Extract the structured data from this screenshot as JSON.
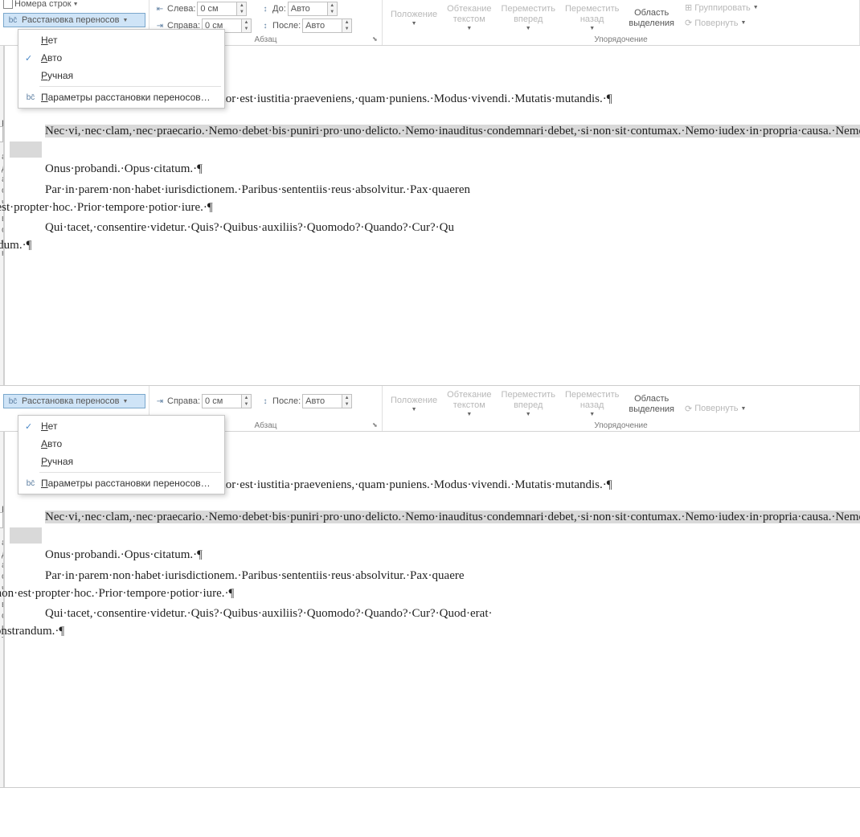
{
  "ribbon": {
    "lineNumbers": "Номера строк",
    "hyphenation": "Расстановка переносов",
    "indentLeftLabel": "Слева:",
    "indentRightLabel": "Справа:",
    "spacingBeforeLabel": "До:",
    "spacingAfterLabel": "После:",
    "indentLeftValue": "0 см",
    "indentRightValue": "0 см",
    "spacingBeforeValue": "Авто",
    "spacingAfterValue": "Авто",
    "groupParagraph": "Абзац",
    "groupArrange": "Упорядочение",
    "position": "Положение",
    "wrapText1": "Обтекание",
    "wrapText2": "текстом",
    "bringForward1": "Переместить",
    "bringForward2": "вперед",
    "sendBackward1": "Переместить",
    "sendBackward2": "назад",
    "selectionPane1": "Область",
    "selectionPane2": "выделения",
    "group": "Группировать",
    "rotate": "Повернуть"
  },
  "menu": {
    "none": "Нет",
    "auto": "Авто",
    "manual": "Ручная",
    "options": "Параметры расстановки переносов…"
  },
  "leftPane": {
    "results": "РЕЗУЛЬ",
    "frag1": "ю",
    "frag2a": "акой",
    "frag2b": "дитесь, а",
    "frag2c": "о части.",
    "frag3a": "вкладку",
    "frag3b": "оловков к",
    "frag3c": "нте.",
    "frag3b2": "оловков к",
    "frag3c2": "те."
  },
  "doc": {
    "p1": "·est·causa·possidentis.·Melior·est·iustitia·praeveniens,·quam·puniens.·Modus·vivendi.·Mutatis·mutandis.·¶",
    "p2": "Nec·vi,·nec·clam,·nec·praecario.·Nemo·debet·bis·puniri·pro·uno·delicto.·Nemo·inauditus·condemnari·debet,·si·non·sit·contumax.·Nemo·iudex·in·propria·causa.·Nemo·pluris·iuris·ad·alium·transfere·potest,·quam·ipse·haberet.·Nemo·praesens·nisi·intelligat.·Nemo·praesumitur·malus.·Non·bis·in·idem.·Non·efficit·affectus·nisi·sequatur·effectus.·Non·obligat·lex,·nisi·promulgata.·Non·omne,·quod·licet,·honestum·est.·Non·progredi·est·regredi.·Non·videtur·vim·facere,·qui·iure·suo·utitur.·Nullum·crimen,·nulla·poena·sine·lege.·¶",
    "p3": "Onus·probandi.·Opus·citatum.·¶",
    "p4a": "Par·in·parem·non·habet·iurisdictionem.·Paribus·sententiis·reus·absolvitur.·Pax·quaeren",
    "p4b": "non·est·propter·hoc.·Prior·tempore·potior·iure.·¶",
    "p5a": "Qui·tacet,·consentire·videtur.·Quis?·Quibus·auxiliis?·Quomodo?·Quando?·Cur?·Qu",
    "p5b": "strandum.·¶",
    "p4a2": "Par·in·parem·non·habet·iurisdictionem.·Paribus·sententiis·reus·absolvitur.·Pax·quaere",
    "p4b2": "hoc·non·est·propter·hoc.·Prior·tempore·potior·iure.·¶",
    "p5a2": "Qui·tacet,·consentire·videtur.·Quis?·Quibus·auxiliis?·Quomodo?·Quando?·Cur?·Quod·erat·",
    "p5b2": "demonstrandum.·¶",
    "p2b": "Nec·vi,·nec·clam,·nec·praecario.·Nemo·debet·bis·puniri·pro·uno·delicto.·Nemo·inauditus·condemnari·debet,·si·non·sit·contumax.·Nemo·iudex·in·propria·causa.·Nemo·pluris·iuris·ad·alium·transfere·potest,·quam·ipse·haberet.·Nemo·praesens·nisi·intelligat.·Nemo·praesumitur·malus.·Non·bis·in·idem.·Non·efficit·affectus·nisi·sequatur·effectus.·Non·obligat·lex,·nisi·promulgata.·Non·omne,·quod·licet,·honestum·est.·Non·progredi·est·regredi.·Non·videtur·vim·facere,·qui·iure·suo·utitur.·Nullum·crimen,·nulla·poena·sine·lege.·¶"
  }
}
